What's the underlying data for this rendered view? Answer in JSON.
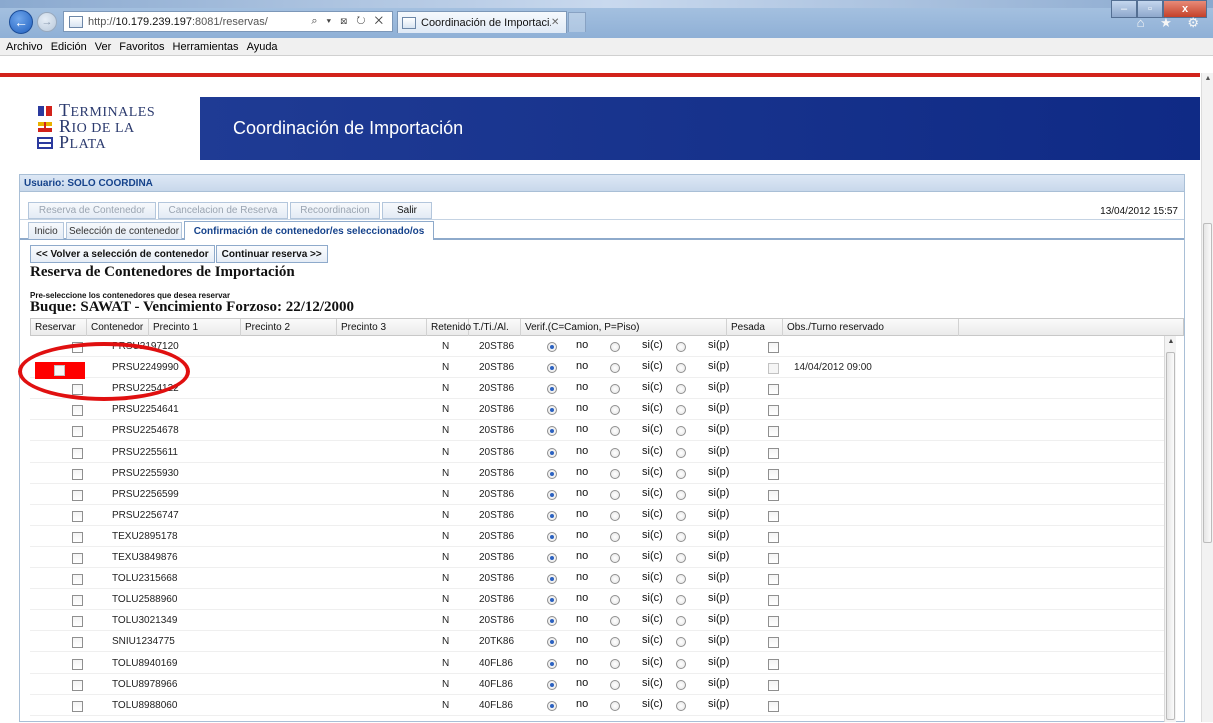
{
  "browser": {
    "url_prefix": "http://",
    "url_host": "10.179.239.197",
    "url_rest": ":8081/reservas/",
    "address_tools": "⌕ ▾ ⊠ ↻ ✕",
    "tab_title": "Coordinación de Importaci...",
    "tab_close": "✕",
    "back": "←",
    "forward": "→",
    "win_min": "–",
    "win_max": "▫",
    "win_close": "x",
    "right_icons": "⌂ ★ ⚙"
  },
  "menu": [
    "Archivo",
    "Edición",
    "Ver",
    "Favoritos",
    "Herramientas",
    "Ayuda"
  ],
  "logo": {
    "line1_cap": "T",
    "line1_rest": "ERMINALES",
    "line2_cap": "R",
    "line2_rest": "IO DE LA",
    "line3_cap": "P",
    "line3_rest": "LATA"
  },
  "banner_title": "Coordinación de Importación",
  "user_label": "Usuario: SOLO COORDINA",
  "toolbar": {
    "reserva": "Reserva de Contenedor",
    "cancelacion": "Cancelacion de Reserva",
    "recoordinacion": "Recoordinacion",
    "salir": "Salir"
  },
  "datetime": "13/04/2012 15:57",
  "tabs": {
    "inicio": "Inicio",
    "seleccion": "Selección de contenedor",
    "confirmacion": "Confirmación de contenedor/es seleccionado/os"
  },
  "actions": {
    "volver": "<< Volver a selección de contenedor",
    "continuar": "Continuar reserva >>"
  },
  "section_title": "Reserva de Contenedores de Importación",
  "section_hint": "Pre-seleccione los contenedores que desea reservar",
  "vessel_line": "Buque: SAWAT  -  Vencimiento Forzoso: 22/12/2000",
  "columns": {
    "reservar": "Reservar",
    "contenedor": "Contenedor",
    "precinto1": "Precinto 1",
    "precinto2": "Precinto 2",
    "precinto3": "Precinto 3",
    "retenido": "Retenido",
    "tipo": "T./Ti./Al.",
    "verif": "Verif.(C=Camion, P=Piso)",
    "pesada": "Pesada",
    "obs": "Obs./Turno reservado"
  },
  "radio_labels": {
    "no": "no",
    "sic": "si(c)",
    "sip": "si(p)"
  },
  "rows": [
    {
      "contenedor": "PRSU2197120",
      "retenido": "N",
      "tipo": "20ST86",
      "obs": ""
    },
    {
      "contenedor": "PRSU2249990",
      "retenido": "N",
      "tipo": "20ST86",
      "obs": "14/04/2012 09:00",
      "reserved": true
    },
    {
      "contenedor": "PRSU2254122",
      "retenido": "N",
      "tipo": "20ST86",
      "obs": ""
    },
    {
      "contenedor": "PRSU2254641",
      "retenido": "N",
      "tipo": "20ST86",
      "obs": ""
    },
    {
      "contenedor": "PRSU2254678",
      "retenido": "N",
      "tipo": "20ST86",
      "obs": ""
    },
    {
      "contenedor": "PRSU2255611",
      "retenido": "N",
      "tipo": "20ST86",
      "obs": ""
    },
    {
      "contenedor": "PRSU2255930",
      "retenido": "N",
      "tipo": "20ST86",
      "obs": ""
    },
    {
      "contenedor": "PRSU2256599",
      "retenido": "N",
      "tipo": "20ST86",
      "obs": ""
    },
    {
      "contenedor": "PRSU2256747",
      "retenido": "N",
      "tipo": "20ST86",
      "obs": ""
    },
    {
      "contenedor": "TEXU2895178",
      "retenido": "N",
      "tipo": "20ST86",
      "obs": ""
    },
    {
      "contenedor": "TEXU3849876",
      "retenido": "N",
      "tipo": "20ST86",
      "obs": ""
    },
    {
      "contenedor": "TOLU2315668",
      "retenido": "N",
      "tipo": "20ST86",
      "obs": ""
    },
    {
      "contenedor": "TOLU2588960",
      "retenido": "N",
      "tipo": "20ST86",
      "obs": ""
    },
    {
      "contenedor": "TOLU3021349",
      "retenido": "N",
      "tipo": "20ST86",
      "obs": ""
    },
    {
      "contenedor": "SNIU1234775",
      "retenido": "N",
      "tipo": "20TK86",
      "obs": ""
    },
    {
      "contenedor": "TOLU8940169",
      "retenido": "N",
      "tipo": "40FL86",
      "obs": ""
    },
    {
      "contenedor": "TOLU8978966",
      "retenido": "N",
      "tipo": "40FL86",
      "obs": ""
    },
    {
      "contenedor": "TOLU8988060",
      "retenido": "N",
      "tipo": "40FL86",
      "obs": ""
    }
  ]
}
